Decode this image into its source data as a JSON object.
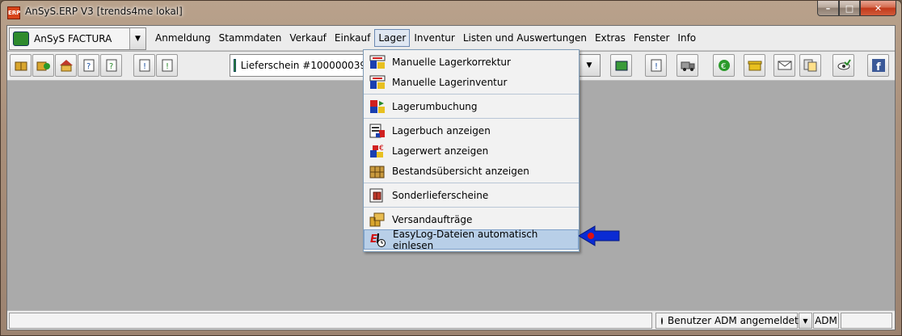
{
  "window": {
    "app_icon_text": "ERP",
    "title": "AnSyS.ERP V3  [trends4me lokal]",
    "minimize": "–",
    "maximize": "□",
    "close": "✕"
  },
  "company_selector": {
    "value": "AnSyS FACTURA",
    "icon": "company-icon"
  },
  "menubar": {
    "items": [
      {
        "label": "Anmeldung"
      },
      {
        "label": "Stammdaten"
      },
      {
        "label": "Verkauf"
      },
      {
        "label": "Einkauf"
      },
      {
        "label": "Lager"
      },
      {
        "label": "Inventur"
      },
      {
        "label": "Listen und Auswertungen"
      },
      {
        "label": "Extras"
      },
      {
        "label": "Fenster"
      },
      {
        "label": "Info"
      }
    ],
    "active": "Lager"
  },
  "toolbar": {
    "document_selector": "Lieferschein #100000039"
  },
  "lager_menu": {
    "items": [
      {
        "label": "Manuelle Lagerkorrektur",
        "icon": "lagerkorrektur-icon"
      },
      {
        "label": "Manuelle Lagerinventur",
        "icon": "lagerinventur-icon"
      },
      {
        "label": "Lagerumbuchung",
        "icon": "lagerumbuchung-icon"
      },
      {
        "label": "Lagerbuch anzeigen",
        "icon": "lagerbuch-icon"
      },
      {
        "label": "Lagerwert anzeigen",
        "icon": "lagerwert-icon"
      },
      {
        "label": "Bestandsübersicht anzeigen",
        "icon": "bestandsuebersicht-icon"
      },
      {
        "label": "Sonderlieferscheine",
        "icon": "sonderlieferscheine-icon"
      },
      {
        "label": "Versandaufträge",
        "icon": "versandauftraege-icon"
      },
      {
        "label": "EasyLog-Dateien automatisch einlesen",
        "icon": "easylog-icon"
      }
    ],
    "highlighted": "EasyLog-Dateien automatisch einlesen"
  },
  "statusbar": {
    "user_status": "Benutzer ADM angemeldet",
    "user_code": "ADM"
  },
  "colors": {
    "highlight": "#b8cfe8",
    "arrow": "#0a2bd4",
    "arrow_dot": "#e01010"
  }
}
